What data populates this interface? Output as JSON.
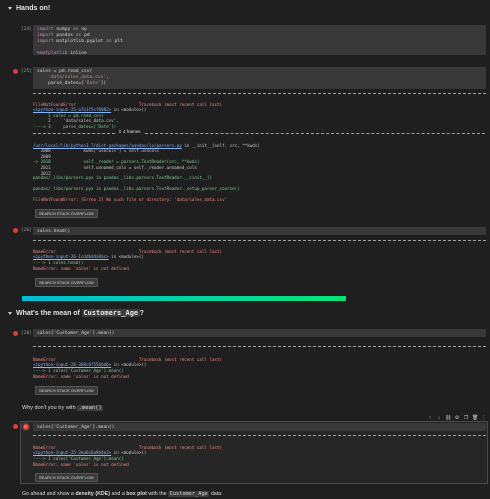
{
  "section1": {
    "title": "Hands on!"
  },
  "cell24": {
    "count": "[24]",
    "lines": [
      "import numpy as np",
      "import pandas as pd",
      "import matplotlib.pyplot as plt",
      "",
      "%matplotlib inline"
    ]
  },
  "cell25": {
    "count": "[25]",
    "lines": [
      "sales = pd.read_csv(",
      "    'data/sales_data.csv',",
      "    parse_dates=['Date'])"
    ],
    "error_header": "FileNotFoundError                         Traceback (most recent call last)",
    "error_link": "<ipython-input-25-a7a1f5cf6882>",
    "error_in_module": " in <module>()",
    "tb_lines": [
      "      1 sales = pd.read_csv(",
      "      2     'data/sales_data.csv',",
      "----> 3     parse_dates=['Date'])"
    ],
    "frames_label": "4 frames",
    "frame_link": "/usr/local/lib/python3.7/dist-packages/pandas/io/parsers.py",
    "frame_in": " in __init__(self, src, **kwds)",
    "frame_lines": [
      "   2008             kwds[\"usecols\"] = self.usecols",
      "   2009",
      "-> 2010             self._reader = parsers.TextReader(src, **kwds)",
      "   2011             self.unnamed_cols = self._reader.unnamed_cols",
      "   2012"
    ],
    "reader_line1": "pandas/_libs/parsers.pyx in pandas._libs.parsers.TextReader.__cinit__()",
    "reader_line2": "pandas/_libs/parsers.pyx in pandas._libs.parsers.TextReader._setup_parser_source()",
    "final_error": "FileNotFoundError: [Errno 2] No such file or directory: 'data/sales_data.csv'",
    "so_button": "SEARCH STACK OVERFLOW"
  },
  "cell26": {
    "count": "[26]",
    "code": "sales.head()",
    "error_header": "NameError                                 Traceback (most recent call last)",
    "error_link": "<ipython-input-26-1cddbd4a9ac>",
    "error_in_module": " in <module>()",
    "tb_line": "----> 1 sales.head()",
    "final_error": "NameError: name 'sales' is not defined",
    "so_button": "SEARCH STACK OVERFLOW"
  },
  "divider": {
    "color_start": "#00bcd4",
    "color_end": "#00e676"
  },
  "section2": {
    "prefix": "What's the mean of ",
    "code": "Customers_Age",
    "suffix": "?"
  },
  "cell28": {
    "count": "[28]",
    "code": "sales['Customer_Age'].mean()",
    "error_header": "NameError                                 Traceback (most recent call last)",
    "error_link": "<ipython-input-28-368c6f55b6d6>",
    "error_in_module": " in <module>()",
    "tb_line": "----> 1 sales['Customer_Age'].mean()",
    "final_error": "NameError: name 'sales' is not defined",
    "so_button": "SEARCH STACK OVERFLOW"
  },
  "hint": {
    "prefix": "Why don't you try with ",
    "code": ".mean()"
  },
  "cell_active": {
    "code": "sales['Customer_Age'].mean()",
    "error_header": "NameError                                 Traceback (most recent call last)",
    "error_link": "<ipython-input-25-3ea6c6a9b4e3>",
    "error_in_module": " in <module>()",
    "tb_line": "----> 1 sales['Customer_Age'].mean()",
    "final_error": "NameError: name 'sales' is not defined",
    "so_button": "SEARCH STACK OVERFLOW",
    "toolbar_icons": [
      "arrow-up-icon",
      "arrow-down-icon",
      "link-icon",
      "gear-icon",
      "copy-icon",
      "delete-icon",
      "more-icon"
    ]
  },
  "footer": {
    "prefix": "Go ahead and show a ",
    "bold1": "density (KDE)",
    "mid": " and a ",
    "bold2": "box plot",
    "suffix": " with the ",
    "code": "Customer_Age",
    "end": " data:"
  }
}
